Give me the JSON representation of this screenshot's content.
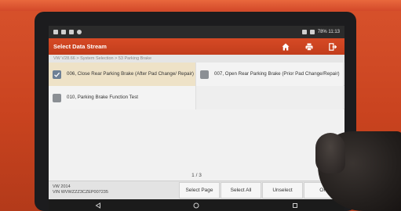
{
  "status": {
    "right_text": "78% 11:13"
  },
  "app": {
    "title": "Select Data Stream"
  },
  "breadcrumb": "VW V28.66 > System Selection > 53 Parking Brake",
  "items": [
    {
      "label": "006, Close Rear Parking Brake (After Pad Change/ Repair)",
      "checked": true
    },
    {
      "label": "007, Open Rear Parking Brake (Prior Pad Change/Repair)",
      "checked": false
    },
    {
      "label": "010, Parking Brake Function Test",
      "checked": false
    }
  ],
  "pager": "1 / 3",
  "vehicle": {
    "line1": "VW  2014",
    "line2": "VIN WVWZZZ3CZEP007235"
  },
  "buttons": {
    "select_page": "Select Page",
    "select_all": "Select All",
    "unselect": "Unselect",
    "ok": "OK"
  },
  "icons": {
    "home": "home-icon",
    "print": "print-icon",
    "exit": "exit-icon",
    "nav_back": "back-icon",
    "nav_home": "home-circle-icon",
    "nav_recent": "recent-apps-icon"
  },
  "colors": {
    "accent": "#c9431f",
    "selected_row": "#eee2c7"
  }
}
